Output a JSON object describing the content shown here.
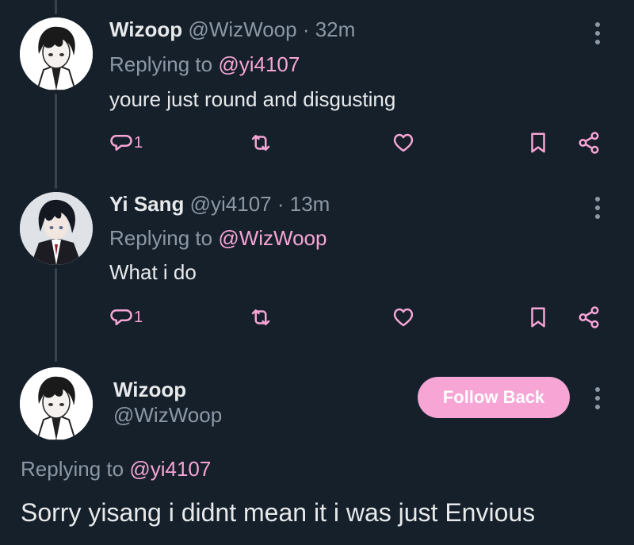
{
  "colors": {
    "background": "#15202b",
    "accent": "#f6a5d5",
    "muted": "#8b98a5",
    "text": "#e7e9ea"
  },
  "tweets": [
    {
      "name": "Wizoop",
      "handle": "@WizWoop",
      "time": "· 32m",
      "reply_prefix": "Replying to",
      "reply_handle": "@yi4107",
      "text": "youre just round and disgusting",
      "reply_count": "1"
    },
    {
      "name": "Yi Sang",
      "handle": "@yi4107",
      "time": "· 13m",
      "reply_prefix": "Replying to",
      "reply_handle": "@WizWoop",
      "text": "What i do",
      "reply_count": "1"
    }
  ],
  "main": {
    "name": "Wizoop",
    "handle": "@WizWoop",
    "follow_label": "Follow Back",
    "reply_prefix": "Replying to",
    "reply_handle": "@yi4107",
    "text": "Sorry yisang i didnt mean it i was just Envious"
  },
  "icons": [
    "reply-icon",
    "retweet-icon",
    "like-icon",
    "bookmark-icon",
    "share-icon",
    "more-icon"
  ]
}
